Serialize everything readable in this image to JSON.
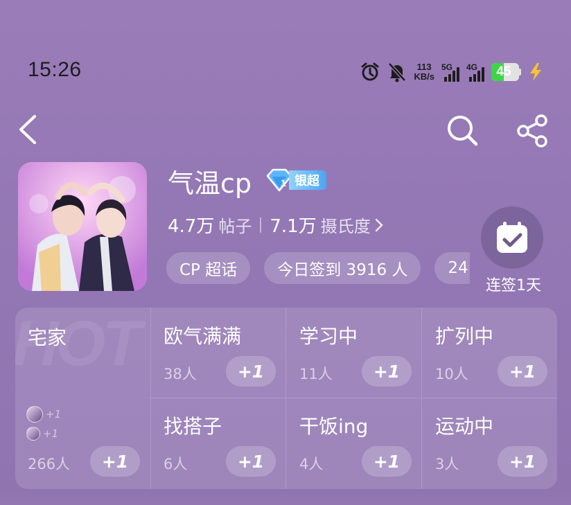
{
  "status_bar": {
    "time": "15:26",
    "speed_value": "113",
    "speed_unit": "KB/s",
    "net1_label": "5G",
    "net2_label": "4G",
    "battery": "45",
    "battery_fraction": 0.45,
    "icons": [
      "alarm-icon",
      "mute-bell-icon",
      "signal-5g-icon",
      "signal-4g-icon",
      "battery-icon",
      "charging-bolt-icon"
    ]
  },
  "nav": {
    "back_icon": "chevron-left-icon",
    "search_icon": "search-icon",
    "share_icon": "share-icon"
  },
  "topic": {
    "title": "气温cp",
    "badge_level": "1",
    "badge_label": "银超",
    "posts_value": "4.7万",
    "posts_label": "帖子",
    "heat_value": "7.1万",
    "heat_label": "摄氏度",
    "chips": [
      "CP 超话",
      "今日签到 3916 人",
      "24"
    ]
  },
  "signin": {
    "label": "连签1天",
    "icon": "calendar-check-icon"
  },
  "groups": {
    "hot_watermark": "HOT",
    "featured": {
      "name": "宅家",
      "count": "266人",
      "action": "+1",
      "mini_actions": [
        "+1",
        "+1"
      ]
    },
    "items": [
      {
        "name": "欧气满满",
        "count": "38人",
        "action": "+1"
      },
      {
        "name": "学习中",
        "count": "11人",
        "action": "+1"
      },
      {
        "name": "扩列中",
        "count": "10人",
        "action": "+1"
      },
      {
        "name": "找搭子",
        "count": "6人",
        "action": "+1"
      },
      {
        "name": "干饭ing",
        "count": "4人",
        "action": "+1"
      },
      {
        "name": "运动中",
        "count": "3人",
        "action": "+1"
      }
    ]
  },
  "colors": {
    "background": "#9a7cb8",
    "badge_blue": "#4ba6f2",
    "battery_green": "#3ed447",
    "charge_yellow": "#f4c531"
  }
}
